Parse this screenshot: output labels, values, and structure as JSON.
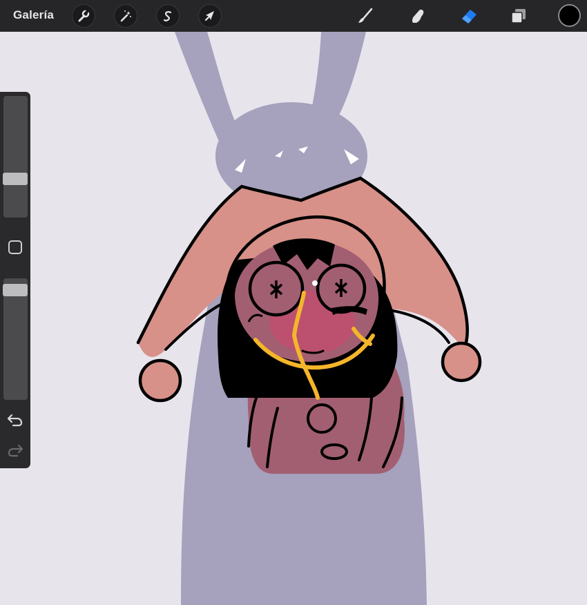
{
  "toolbar": {
    "gallery_label": "Galería",
    "left_tools": [
      {
        "name": "actions",
        "icon": "wrench-icon"
      },
      {
        "name": "adjustments",
        "icon": "magic-wand-icon"
      },
      {
        "name": "selection",
        "icon": "selection-s-icon"
      },
      {
        "name": "transform",
        "icon": "arrow-cursor-icon"
      }
    ],
    "right_tools": [
      {
        "name": "brush",
        "icon": "brush-icon",
        "active": false
      },
      {
        "name": "smudge",
        "icon": "smudge-finger-icon",
        "active": false
      },
      {
        "name": "eraser",
        "icon": "eraser-icon",
        "active": true
      },
      {
        "name": "layers",
        "icon": "layers-icon",
        "active": false
      }
    ],
    "current_color": "#000000",
    "accent_color": "#1e7cf0"
  },
  "sidebar": {
    "brush_size_level": 0.3,
    "opacity_level": 0.95,
    "buttons": [
      "modify-square-icon",
      "undo-icon",
      "redo-icon"
    ]
  },
  "canvas": {
    "background_color": "#e8e4ec",
    "colors": {
      "silhouette": "#a6a1bd",
      "hat": "#d79189",
      "body": "#a25f72",
      "line": "#000000",
      "drip": "#f5b52b",
      "blush": "#d0456e"
    }
  }
}
